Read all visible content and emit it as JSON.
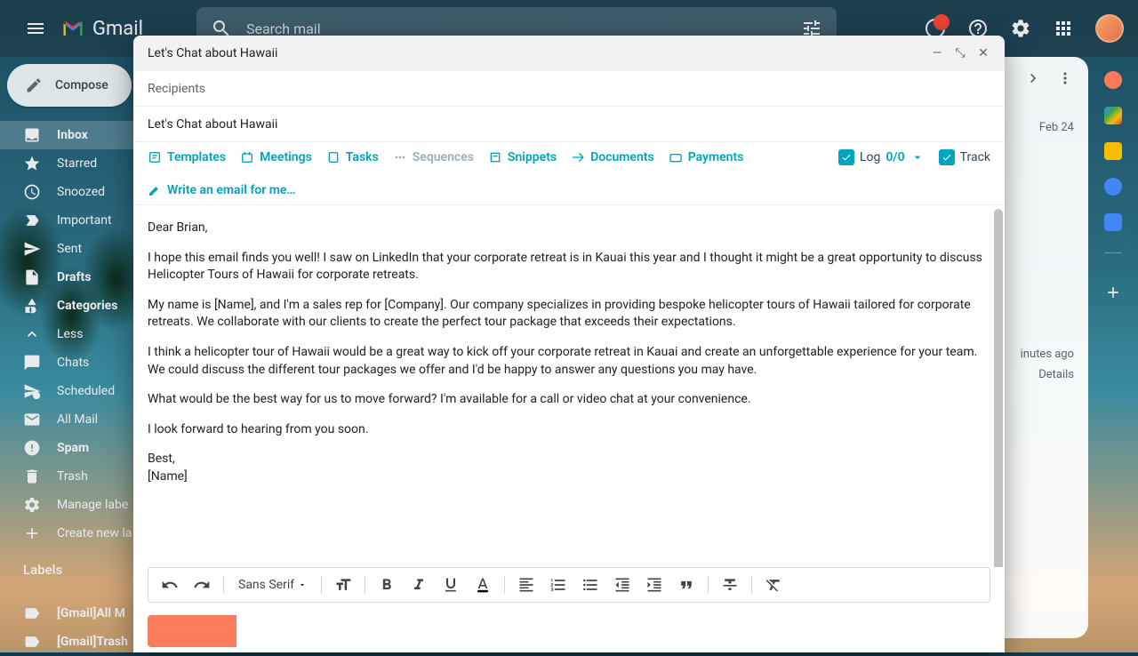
{
  "app": {
    "name": "Gmail"
  },
  "search": {
    "placeholder": "Search mail"
  },
  "notifications": {
    "count": ""
  },
  "compose_button": {
    "label": "Compose"
  },
  "sidebar": {
    "items": [
      {
        "label": "Inbox",
        "icon": "inbox",
        "active": true,
        "bold": true
      },
      {
        "label": "Starred",
        "icon": "star"
      },
      {
        "label": "Snoozed",
        "icon": "clock"
      },
      {
        "label": "Important",
        "icon": "important"
      },
      {
        "label": "Sent",
        "icon": "send"
      },
      {
        "label": "Drafts",
        "icon": "draft",
        "bold": true
      },
      {
        "label": "Categories",
        "icon": "category",
        "bold": true
      },
      {
        "label": "Less",
        "icon": "less"
      },
      {
        "label": "Chats",
        "icon": "chat"
      },
      {
        "label": "Scheduled",
        "icon": "schedule"
      },
      {
        "label": "All Mail",
        "icon": "allmail"
      },
      {
        "label": "Spam",
        "icon": "spam",
        "bold": true
      },
      {
        "label": "Trash",
        "icon": "trash"
      },
      {
        "label": "Manage labe",
        "icon": "gear"
      },
      {
        "label": "Create new la",
        "icon": "plus"
      }
    ],
    "labels_header": "Labels",
    "user_labels": [
      {
        "label": "[Gmail]All M"
      },
      {
        "label": "[Gmail]Trash"
      }
    ]
  },
  "main": {
    "date": "Feb 24",
    "activity": "inutes ago",
    "details": "Details"
  },
  "compose": {
    "title": "Let's Chat about Hawaii",
    "recipients_label": "Recipients",
    "subject": "Let's Chat about Hawaii",
    "hubspot": {
      "templates": "Templates",
      "meetings": "Meetings",
      "tasks": "Tasks",
      "sequences": "Sequences",
      "snippets": "Snippets",
      "documents": "Documents",
      "payments": "Payments",
      "log": "Log",
      "log_count": "0/0",
      "track": "Track",
      "write_ai": "Write an email for me…"
    },
    "body": {
      "greeting": "Dear Brian,",
      "p1": "I hope this email finds you well! I saw on LinkedIn that your corporate retreat is in Kauai this year and I thought it might be a great opportunity to discuss Helicopter Tours of Hawaii for corporate retreats.",
      "p2": "My name is [Name], and I'm a sales rep for [Company]. Our company specializes in providing bespoke helicopter tours of Hawaii tailored for corporate retreats. We collaborate with our clients to create the perfect tour package that exceeds their expectations.",
      "p3": "I think a helicopter tour of Hawaii would be a great way to kick off your corporate retreat in Kauai and create an unforgettable experience for your team. We could discuss the different tour packages we offer and I'd be happy to answer any questions you may have.",
      "p4": "What would be the best way for us to move forward? I'm available for a call or video chat at your convenience.",
      "p5": "I look forward to hearing from you soon.",
      "signoff": "Best,",
      "name": "[Name]"
    },
    "format": {
      "font": "Sans Serif"
    }
  }
}
